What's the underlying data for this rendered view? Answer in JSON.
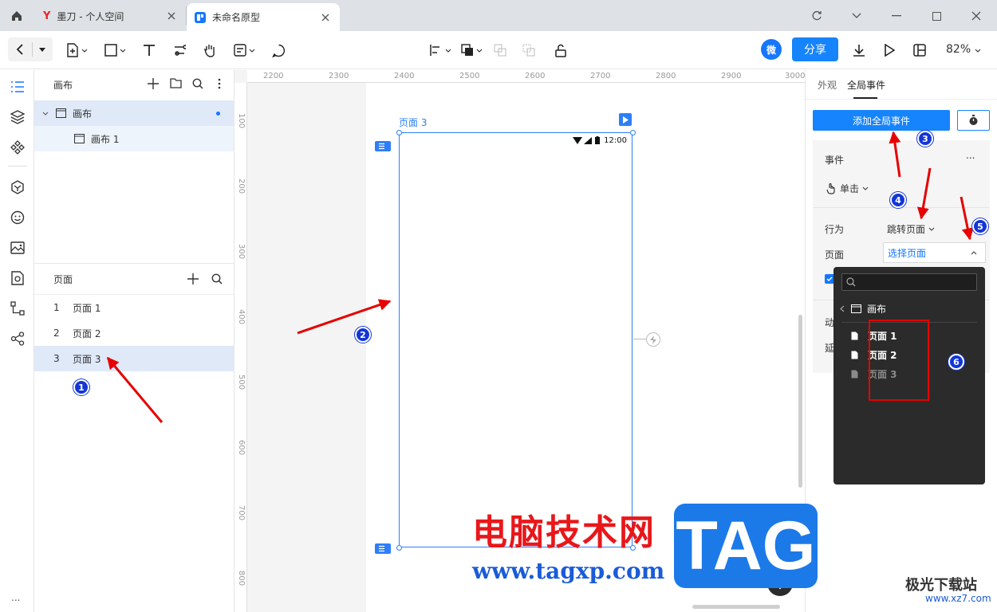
{
  "browser": {
    "tabs": [
      {
        "title": "墨刀 - 个人空间",
        "logo": "Y"
      },
      {
        "title": "未命名原型"
      }
    ]
  },
  "toolbar": {
    "wei_label": "微",
    "share_label": "分享",
    "zoom": "82%"
  },
  "layers": {
    "title": "画布",
    "items": [
      {
        "label": "画布"
      },
      {
        "label": "画布 1"
      }
    ]
  },
  "pages": {
    "title": "页面",
    "items": [
      {
        "num": "1",
        "label": "页面 1"
      },
      {
        "num": "2",
        "label": "页面 2"
      },
      {
        "num": "3",
        "label": "页面 3"
      }
    ]
  },
  "ruler": {
    "top": [
      "2200",
      "2300",
      "2400",
      "2500",
      "2600",
      "2700",
      "2800",
      "2900",
      "3000"
    ],
    "left": [
      "100",
      "200",
      "300",
      "400",
      "500",
      "600",
      "700",
      "800"
    ]
  },
  "canvas": {
    "page_label": "页面 3",
    "status_time": "12:00"
  },
  "inspector": {
    "tabs": [
      "外观",
      "全局事件"
    ],
    "add_event": "添加全局事件",
    "event_label": "事件",
    "more": "...",
    "trigger": "单击",
    "action_label": "行为",
    "action_value": "跳转页面",
    "page_label": "页面",
    "page_value": "选择页面",
    "row_anim": "动",
    "row_delay": "延"
  },
  "dropdown": {
    "folder": "画布",
    "items": [
      {
        "label": "页面 1"
      },
      {
        "label": "页面 2"
      },
      {
        "label": "页面 3"
      }
    ]
  },
  "annotations": [
    "1",
    "2",
    "3",
    "4",
    "5",
    "6"
  ],
  "watermark": {
    "cn": "电脑技术网",
    "url": "www.tagxp.com",
    "tag": "TAG",
    "site": "极光下载站",
    "site_url": "www.xz7.com"
  },
  "rail_more": "...",
  "colors": {
    "accent": "#1684fc",
    "annotation": "#1436d6",
    "arrow": "#e60000"
  }
}
